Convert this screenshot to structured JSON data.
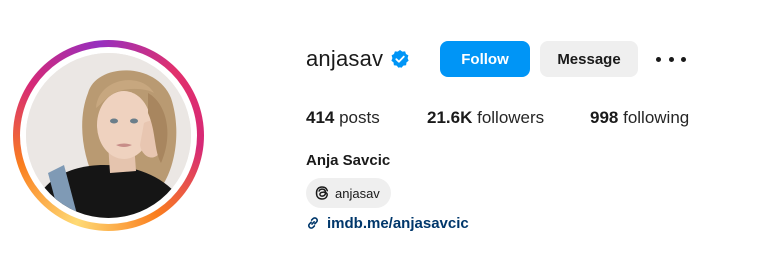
{
  "profile": {
    "username": "anjasav",
    "verified": true,
    "full_name": "Anja Savcic",
    "avatar_alt": "profile-photo"
  },
  "actions": {
    "follow_label": "Follow",
    "message_label": "Message",
    "more_icon": "more-options-icon"
  },
  "stats": {
    "posts_count": "414",
    "posts_label": " posts",
    "followers_count": "21.6K",
    "followers_label": " followers",
    "following_count": "998",
    "following_label": " following"
  },
  "threads": {
    "handle": "anjasav",
    "icon": "threads-icon"
  },
  "link": {
    "text": "imdb.me/anjasavcic",
    "icon": "link-icon"
  },
  "colors": {
    "primary_button": "#0095f6",
    "secondary_button": "#efefef",
    "link": "#00376b",
    "verified_badge": "#0095f6"
  }
}
